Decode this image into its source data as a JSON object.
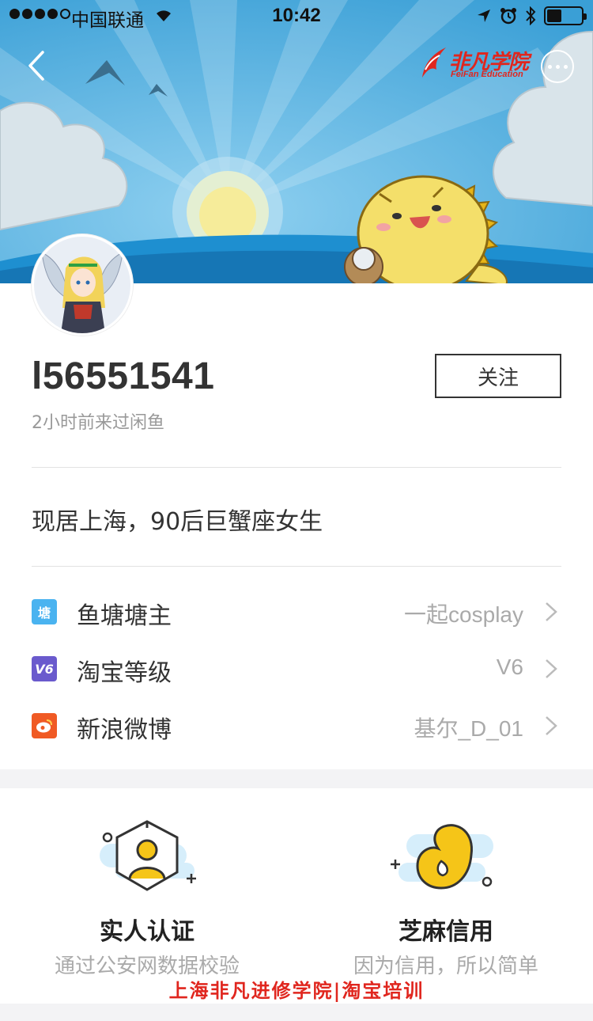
{
  "status_bar": {
    "carrier": "中国联通",
    "time": "10:42"
  },
  "header": {
    "brand_cn": "非凡学院",
    "brand_en": "FeiFan Education"
  },
  "profile": {
    "username": "l56551541",
    "follow_label": "关注",
    "last_visit": "2小时前来过闲鱼",
    "bio": "现居上海，90后巨蟹座女生"
  },
  "info_rows": [
    {
      "icon": "pond-icon",
      "icon_text": "塘",
      "icon_color": "#4ab3f0",
      "label": "鱼塘塘主",
      "value": "一起cosplay"
    },
    {
      "icon": "taobao-level-icon",
      "icon_text": "V6",
      "icon_color": "#6a5acd",
      "label": "淘宝等级",
      "value": "V6"
    },
    {
      "icon": "weibo-icon",
      "icon_text": "",
      "icon_color": "#f05a24",
      "label": "新浪微博",
      "value": "基尔_D_01"
    }
  ],
  "features": [
    {
      "title": "实人认证",
      "desc": "通过公安网数据校验"
    },
    {
      "title": "芝麻信用",
      "desc": "因为信用，所以简单"
    }
  ],
  "watermark": "上海非凡进修学院|淘宝培训",
  "colors": {
    "sky": "#5cb4e2",
    "brand_red": "#e0261e",
    "accent_yellow": "#f5c518"
  }
}
